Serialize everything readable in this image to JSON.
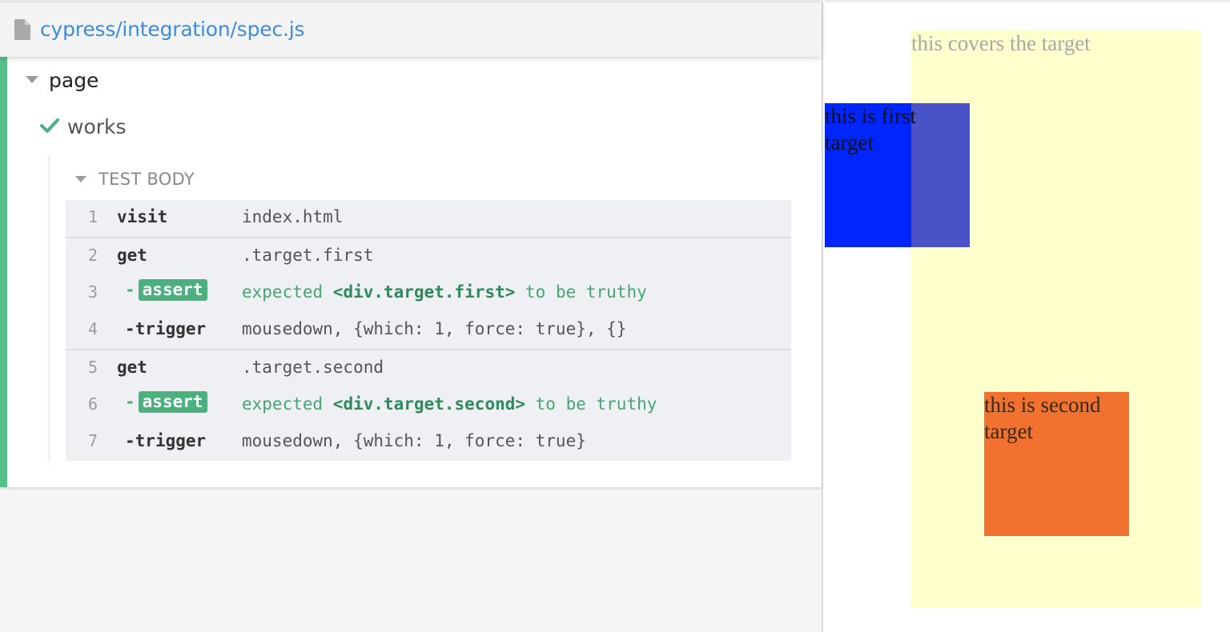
{
  "spec": {
    "path": "cypress/integration/spec.js",
    "icon": "file-icon"
  },
  "suite": {
    "title": "page",
    "test": {
      "title": "works",
      "status": "passed",
      "status_icon": "check-icon"
    },
    "hook": {
      "title": "TEST BODY"
    }
  },
  "commands": [
    {
      "num": "1",
      "name": "visit",
      "message": "index.html"
    },
    {
      "num": "2",
      "name": "get",
      "message": ".target.first"
    },
    {
      "num": "3",
      "dash": "-",
      "name": "assert",
      "msg_pre": "expected ",
      "msg_strong": "<div.target.first>",
      "msg_post": " to be truthy"
    },
    {
      "num": "4",
      "dash": "-",
      "name": "trigger",
      "message": "mousedown, {which: 1, force: true}, {}"
    },
    {
      "num": "5",
      "name": "get",
      "message": ".target.second"
    },
    {
      "num": "6",
      "dash": "-",
      "name": "assert",
      "msg_pre": "expected ",
      "msg_strong": "<div.target.second>",
      "msg_post": " to be truthy"
    },
    {
      "num": "7",
      "dash": "-",
      "name": "trigger",
      "message": "mousedown, {which: 1, force: true}"
    }
  ],
  "app": {
    "cover_text": "this covers the target",
    "first_text": "this is first target",
    "second_text": "this is second target",
    "colors": {
      "first": "#0026fb",
      "second": "#f07130",
      "cover": "#ffffbe"
    }
  },
  "colors": {
    "pass": "#55bf8a",
    "link": "#3d8ce0"
  }
}
